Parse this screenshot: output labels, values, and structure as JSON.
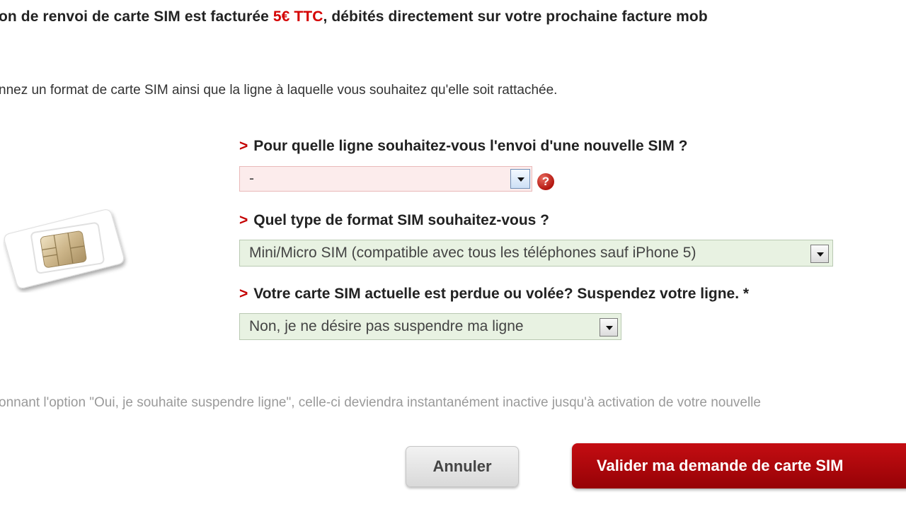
{
  "notice": {
    "fee_prefix": "on de renvoi de carte SIM est facturée ",
    "fee_price": "5€ TTC",
    "fee_suffix": ", débités directement sur votre prochaine facture mob",
    "instruction": "nnez un format de carte SIM ainsi que la ligne à laquelle vous souhaitez qu'elle soit rattachée."
  },
  "form": {
    "arrow": ">",
    "line_question": "Pour quelle ligne souhaitez-vous l'envoi d'une nouvelle SIM ?",
    "line_value": "-",
    "error_icon_symbol": "?",
    "format_question": "Quel type de format SIM souhaitez-vous ?",
    "format_value": "Mini/Micro SIM (compatible avec tous les téléphones sauf iPhone 5)",
    "suspend_question": "Votre carte SIM actuelle est perdue ou volée? Suspendez votre ligne. *",
    "suspend_value": "Non, je ne désire pas suspendre ma ligne"
  },
  "note": "onnant l'option \"Oui, je souhaite suspendre ligne\", celle-ci deviendra instantanément inactive jusqu'à activation de votre nouvelle",
  "buttons": {
    "cancel_label": "Annuler",
    "submit_label": "Valider ma demande de carte SIM"
  },
  "icons": {
    "sim": "sim-card-icon",
    "error": "error-question-icon",
    "dropdown": "chevron-down-icon"
  },
  "colors": {
    "accent_red": "#c40000",
    "price_red": "#d40000",
    "submit_bg": "#b0070c",
    "select_bg": "#e8f2e2",
    "select_error_bg": "#fcecec"
  }
}
